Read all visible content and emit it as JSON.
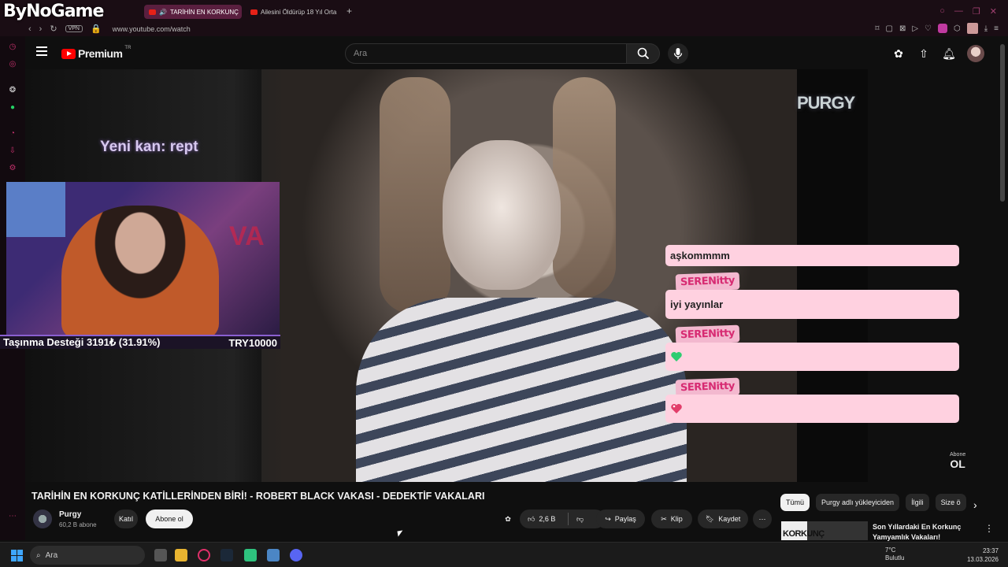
{
  "browser": {
    "overlay_logo": "ByNoGame",
    "tabs": [
      {
        "label": "TARİHİN EN KORKUNÇ",
        "active": true
      },
      {
        "label": "Ailesini Öldürüp 18 Yıl Orta",
        "active": false
      }
    ],
    "new_tab": "+",
    "vpn_label": "VPN",
    "url": "www.youtube.com/watch"
  },
  "youtube_header": {
    "brand": "Premium",
    "region": "TR",
    "search_placeholder": "Ara"
  },
  "video_overlay": {
    "new_subscriber": "Yeni kan: rept",
    "channel_watermark": "PURGY",
    "subscribe_small": "Abone",
    "subscribe_big": "OL",
    "donation_label": "Taşınma Desteği 3191₺ (31.91%)",
    "donation_goal": "TRY10000",
    "donation_progress": 0.3191
  },
  "chat": {
    "messages": [
      {
        "user": "",
        "text": "aşkommmm"
      },
      {
        "user": "SERENitty",
        "text": "iyi yayınlar"
      },
      {
        "user": "SERENitty",
        "text": ""
      },
      {
        "user": "SERENitty",
        "text": ""
      }
    ]
  },
  "video_info": {
    "title": "TARİHİN EN KORKUNÇ KATİLLERİNDEN BİRİ! - ROBERT BLACK VAKASI - DEDEKTİF VAKALARI",
    "channel_name": "Purgy",
    "subscribers": "60,2 B abone",
    "join_label": "Katıl",
    "subscribe_label": "Abone ol",
    "likes": "2,6 B",
    "share_label": "Paylaş",
    "clip_label": "Klip",
    "save_label": "Kaydet"
  },
  "recommendations": {
    "chips": [
      "Tümü",
      "Purgy adlı yükleyiciden",
      "İlgili",
      "Size ö"
    ],
    "items": [
      {
        "thumb_text": "KORKUNÇ",
        "title": "Son Yıllardaki En Korkunç Yamyamlık Vakaları!"
      }
    ]
  },
  "taskbar": {
    "search_label": "Ara",
    "temperature": "7°C",
    "weather": "Bulutlu",
    "time": "23:37",
    "date": "13.03.2026"
  },
  "colors": {
    "chat_bubble": "#ffd1e0",
    "chat_username": "#d72b72",
    "yt_red": "#ff0000",
    "accent_pink": "#c0306a"
  }
}
